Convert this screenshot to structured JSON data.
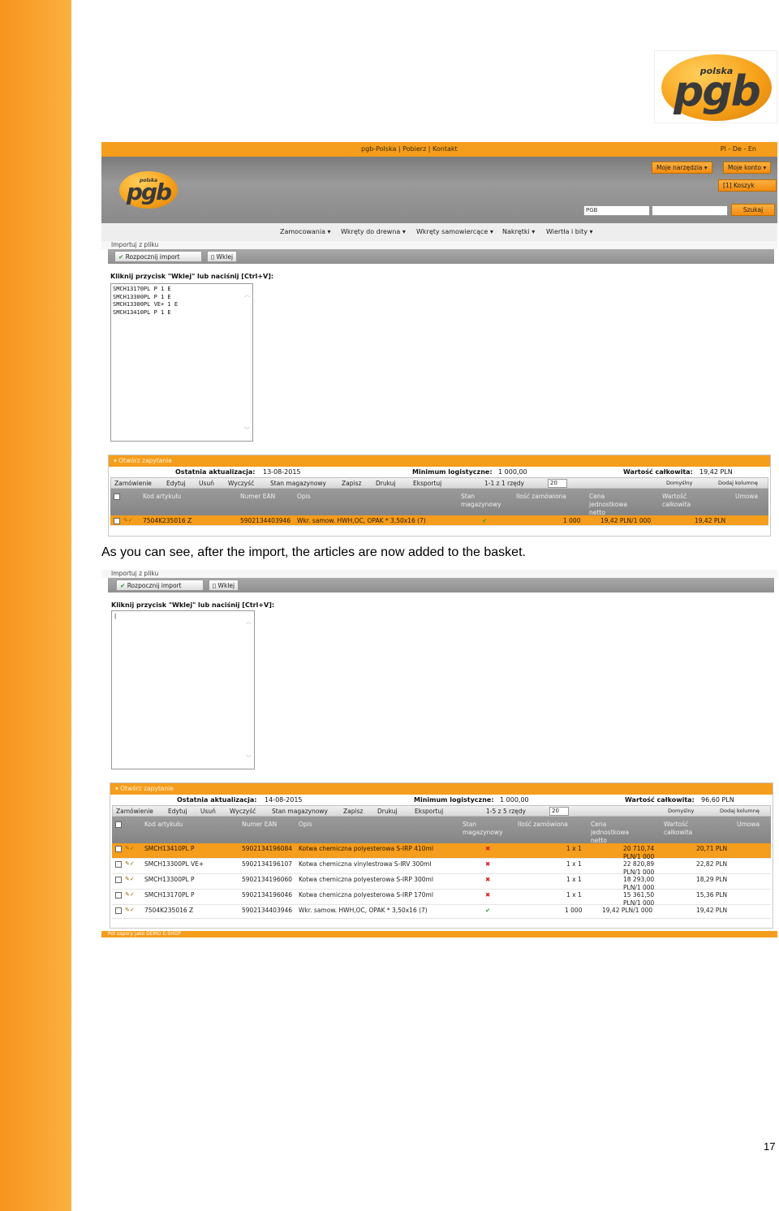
{
  "page": {
    "caption": "As you can see, after the import, the articles are now added to the basket.",
    "page_number": "17"
  },
  "logo": {
    "small": "polska",
    "big": "pgb"
  },
  "shop": {
    "top_links": "pgb-Polska | Pobierz | Kontakt",
    "languages": "Pl - De - En",
    "buttons": {
      "tools": "Moje narzędzia ▾",
      "account": "Moje konto ▾",
      "cart": "[1] Koszyk",
      "search": "Szukaj"
    },
    "search_select": "PGB",
    "menu": [
      "Zamocowania ▾",
      "Wkręty do drewna ▾",
      "Wkręty samowiercące ▾",
      "Nakrętki ▾",
      "Wiertła i bity ▾"
    ]
  },
  "import": {
    "breadcrumb": "Importuj z pliku",
    "start_button": "Rozpocznij import",
    "paste_button": "Wklej",
    "paste_label": "Kliknij przycisk \"Wklej\" lub naciśnij [Ctrl+V]:",
    "textarea_lines": [
      "SMCH13170PL P 1 E",
      "SMCH13300PL P 1 E",
      "SMCH13300PL VE+ 1 E",
      "SMCH13410PL P 1 E"
    ],
    "cursor": "|"
  },
  "grid": {
    "panel_title": "Otwórz zapytanie",
    "labels": {
      "last_update": "Ostatnia aktualizacja:",
      "min_logistic": "Minimum logistyczne:",
      "total_value": "Wartość całkowita:"
    },
    "toolbar": {
      "order": "Zamówienie",
      "edit": "Edytuj",
      "delete": "Usuń",
      "clear": "Wyczyść",
      "stock": "Stan magazynowy",
      "save": "Zapisz",
      "print": "Drukuj",
      "export": "Eksportuj",
      "default": "Domyślny",
      "add_column": "Dodaj kolumnę"
    },
    "columns": {
      "code": "Kod artykułu",
      "ean": "Numer EAN",
      "desc": "Opis",
      "stock1": "Stan",
      "stock2": "magazynowy",
      "qty": "Ilość zamówiona",
      "price1": "Cena",
      "price2": "jednostkowa",
      "price3": "netto",
      "value1": "Wartość",
      "value2": "całkowita",
      "contract": "Umowa"
    }
  },
  "grid1": {
    "last_update": "13-08-2015",
    "min_logistic": "1 000,00",
    "total_value": "19,42 PLN",
    "pager": "1-1 z 1 rzędy",
    "page_size": "20",
    "rows": [
      {
        "code": "7504K235016 Z",
        "ean": "5902134403946",
        "desc": "Wkr. samow. HWH,OC, OPAK * 3,50x16 (7)",
        "stock": "✔",
        "qty": "1 000",
        "price": "19,42 PLN/1 000",
        "price2": "",
        "value": "19,42 PLN",
        "status": "ok"
      }
    ]
  },
  "grid2": {
    "last_update": "14-08-2015",
    "min_logistic": "1 000,00",
    "total_value": "96,60 PLN",
    "pager": "1-5 z 5 rzędy",
    "page_size": "20",
    "rows": [
      {
        "code": "SMCH13410PL P",
        "ean": "5902134196084",
        "desc": "Kotwa chemiczna polyesterowa S-IRP 410ml",
        "stock": "✖",
        "qty": "1 x 1",
        "price": "20 710,74",
        "price2": "PLN/1 000",
        "value": "20,71 PLN",
        "status": "bad"
      },
      {
        "code": "SMCH13300PL VE+",
        "ean": "5902134196107",
        "desc": "Kotwa chemiczna vinylestrowa S-IRV 300ml",
        "stock": "✖",
        "qty": "1 x 1",
        "price": "22 820,89",
        "price2": "PLN/1 000",
        "value": "22,82 PLN",
        "status": "bad"
      },
      {
        "code": "SMCH13300PL P",
        "ean": "5902134196060",
        "desc": "Kotwa chemiczna polyesterowa S-IRP 300ml",
        "stock": "✖",
        "qty": "1 x 1",
        "price": "18 293,00",
        "price2": "PLN/1 000",
        "value": "18,29 PLN",
        "status": "bad"
      },
      {
        "code": "SMCH13170PL P",
        "ean": "5902134196046",
        "desc": "Kotwa chemiczna polyesterowa S-IRP 170ml",
        "stock": "✖",
        "qty": "1 x 1",
        "price": "15 361,50",
        "price2": "PLN/1 000",
        "value": "15,36 PLN",
        "status": "bad"
      },
      {
        "code": "7504K235016 Z",
        "ean": "5902134403946",
        "desc": "Wkr. samow. HWH,OC, OPAK * 3,50x16 (7)",
        "stock": "✔",
        "qty": "1 000",
        "price": "19,42 PLN/1 000",
        "price2": "",
        "value": "19,42 PLN",
        "status": "ok"
      }
    ]
  },
  "footer_strip": "Pół zapory jako DEMO E-SHOP",
  "colors": {
    "orange": "#f59d1c",
    "gray": "#8f8f8f",
    "green": "#2e9e2e",
    "red": "#d62020"
  }
}
